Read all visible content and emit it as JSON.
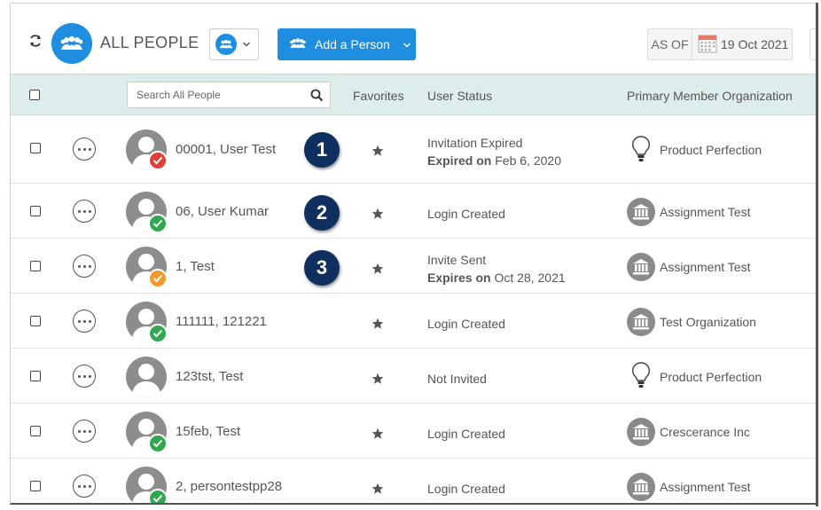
{
  "header": {
    "title": "ALL PEOPLE",
    "add_button_label": "Add a Person",
    "as_of_label": "AS OF",
    "as_of_date": "19 Oct 2021",
    "accent_color": "#1f8ee0"
  },
  "columns": {
    "search_placeholder": "Search All People",
    "favorites": "Favorites",
    "user_status": "User Status",
    "primary_org": "Primary Member Organization"
  },
  "rows": [
    {
      "name": "00001, User Test",
      "badge": "expired-x",
      "callout": "1",
      "status": "Invitation Expired",
      "status_detail_label": "Expired on",
      "status_detail_value": "Feb 6, 2020",
      "org": "Product Perfection",
      "org_icon": "lightbulb-icon"
    },
    {
      "name": "06, User Kumar",
      "badge": "check",
      "callout": "2",
      "status": "Login Created",
      "org": "Assignment Test",
      "org_icon": "building-icon"
    },
    {
      "name": "1, Test",
      "badge": "pending-check",
      "callout": "3",
      "status": "Invite Sent",
      "status_detail_label": "Expires on",
      "status_detail_value": "Oct 28, 2021",
      "org": "Assignment Test",
      "org_icon": "building-icon"
    },
    {
      "name": "111111, 121221",
      "badge": "check",
      "status": "Login Created",
      "org": "Test Organization",
      "org_icon": "building-icon"
    },
    {
      "name": "123tst, Test",
      "badge": "none",
      "status": "Not Invited",
      "org": "Product Perfection",
      "org_icon": "lightbulb-icon"
    },
    {
      "name": "15feb, Test",
      "badge": "check",
      "status": "Login Created",
      "org": "Crescerance Inc",
      "org_icon": "building-icon"
    },
    {
      "name": "2, persontestpp28",
      "badge": "check",
      "status": "Login Created",
      "org": "Assignment Test",
      "org_icon": "building-icon"
    }
  ]
}
